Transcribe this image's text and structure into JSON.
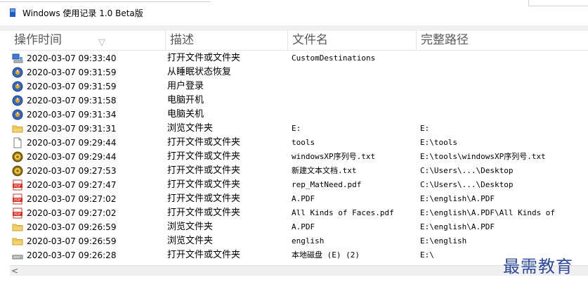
{
  "window": {
    "title": "Windows 使用记录 1.0 Beta版"
  },
  "columns": [
    {
      "label": "操作时间"
    },
    {
      "label": "描述"
    },
    {
      "label": "文件名"
    },
    {
      "label": "完整路径"
    }
  ],
  "sort_indicator": "▽",
  "rows": [
    {
      "icon": "network-computer-icon",
      "time": "2020-03-07 09:33:40",
      "desc": "打开文件或文件夹",
      "file": "CustomDestinations",
      "path": ""
    },
    {
      "icon": "power-icon",
      "time": "2020-03-07 09:31:59",
      "desc": "从睡眠状态恢复",
      "file": "",
      "path": ""
    },
    {
      "icon": "power-icon",
      "time": "2020-03-07 09:31:59",
      "desc": "用户登录",
      "file": "",
      "path": ""
    },
    {
      "icon": "power-icon",
      "time": "2020-03-07 09:31:58",
      "desc": "电脑开机",
      "file": "",
      "path": ""
    },
    {
      "icon": "power-icon",
      "time": "2020-03-07 09:31:34",
      "desc": "电脑关机",
      "file": "",
      "path": ""
    },
    {
      "icon": "folder-icon",
      "time": "2020-03-07 09:31:31",
      "desc": "浏览文件夹",
      "file": "E:",
      "path": "E:"
    },
    {
      "icon": "document-icon",
      "time": "2020-03-07 09:29:44",
      "desc": "打开文件或文件夹",
      "file": "tools",
      "path": "E:\\tools"
    },
    {
      "icon": "text-file-icon",
      "time": "2020-03-07 09:29:44",
      "desc": "打开文件或文件夹",
      "file": "windowsXP序列号.txt",
      "path": "E:\\tools\\windowsXP序列号.txt"
    },
    {
      "icon": "text-file-icon",
      "time": "2020-03-07 09:27:53",
      "desc": "打开文件或文件夹",
      "file": "新建文本文档.txt",
      "path": "C:\\Users\\...\\Desktop"
    },
    {
      "icon": "pdf-icon",
      "time": "2020-03-07 09:27:47",
      "desc": "打开文件或文件夹",
      "file": "rep_MatNeed.pdf",
      "path": "C:\\Users\\...\\Desktop"
    },
    {
      "icon": "pdf-icon",
      "time": "2020-03-07 09:27:02",
      "desc": "打开文件或文件夹",
      "file": "A.PDF",
      "path": "E:\\english\\A.PDF"
    },
    {
      "icon": "pdf-icon",
      "time": "2020-03-07 09:27:02",
      "desc": "打开文件或文件夹",
      "file": "All Kinds of Faces.pdf",
      "path": "E:\\english\\A.PDF\\All Kinds of"
    },
    {
      "icon": "folder-icon",
      "time": "2020-03-07 09:26:59",
      "desc": "浏览文件夹",
      "file": "A.PDF",
      "path": "E:\\english\\A.PDF"
    },
    {
      "icon": "folder-icon",
      "time": "2020-03-07 09:26:59",
      "desc": "浏览文件夹",
      "file": "english",
      "path": "E:\\english"
    },
    {
      "icon": "drive-icon",
      "time": "2020-03-07 09:26:28",
      "desc": "打开文件或文件夹",
      "file": "本地磁盘 (E) (2)",
      "path": "E:\\"
    }
  ],
  "scrollbar": {
    "left_arrow": "<"
  },
  "watermark": "最需教育"
}
